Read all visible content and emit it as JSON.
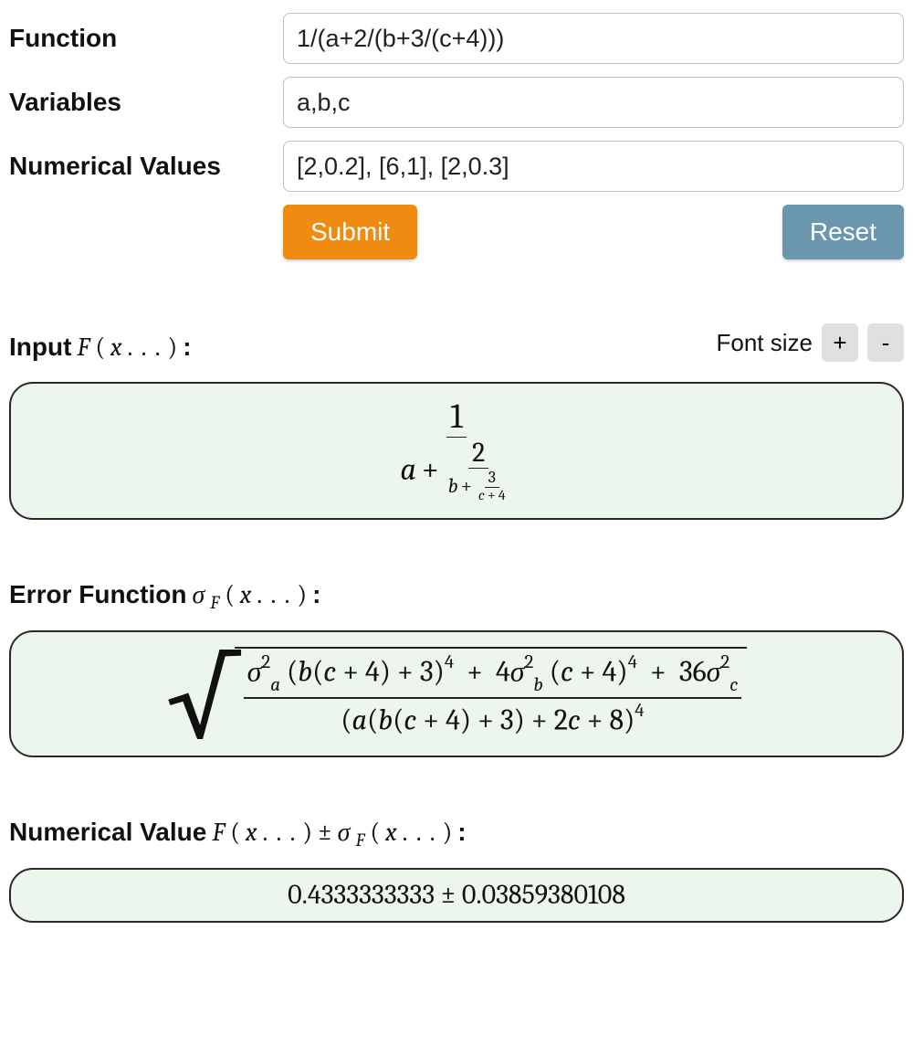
{
  "form": {
    "function_label": "Function",
    "variables_label": "Variables",
    "values_label": "Numerical Values",
    "function_value": "1/(a+2/(b+3/(c+4)))",
    "variables_value": "a,b,c",
    "values_value": "[2,0.2], [6,1], [2,0.3]",
    "submit_label": "Submit",
    "reset_label": "Reset"
  },
  "font_size": {
    "label": "Font size",
    "plus": "+",
    "minus": "-"
  },
  "sections": {
    "input_prefix": "Input ",
    "input_math_F": "F",
    "input_math_open": "(",
    "input_math_x": "x",
    "input_math_dots": ". . .",
    "input_math_close": ")",
    "input_colon": ":",
    "error_prefix": "Error Function ",
    "error_sigma": "σ",
    "error_sub_F": "F",
    "numerical_prefix": "Numerical Value ",
    "pm": "±"
  },
  "formula1": {
    "top": "1",
    "a": "a",
    "plus1": "+",
    "two": "2",
    "b": "b",
    "plus2": "+",
    "three": "3",
    "c": "c",
    "plus3": "+",
    "four": "4"
  },
  "formula2": {
    "num": {
      "t1_sigma": "σ",
      "t1_sup": "2",
      "t1_sub": "a",
      "t1_open": "(",
      "t1_b": "b",
      "t1_open2": "(",
      "t1_c": "c",
      "t1_plus": "+",
      "t1_4": "4",
      "t1_close2": ")",
      "t1_plus2": "+",
      "t1_3": "3",
      "t1_close": ")",
      "t1_pow": "4",
      "plusA": "+",
      "t2_4": "4",
      "t2_sigma": "σ",
      "t2_sup": "2",
      "t2_sub": "b",
      "t2_open": "(",
      "t2_c": "c",
      "t2_plus": "+",
      "t2_fr4": "4",
      "t2_close": ")",
      "t2_pow": "4",
      "plusB": "+",
      "t3_36": "36",
      "t3_sigma": "σ",
      "t3_sup": "2",
      "t3_sub": "c"
    },
    "den": {
      "open": "(",
      "a": "a",
      "open2": "(",
      "b": "b",
      "open3": "(",
      "c": "c",
      "plus1": "+",
      "four": "4",
      "close3": ")",
      "plus2": "+",
      "three": "3",
      "close2": ")",
      "plus3": "+",
      "two_c": "2",
      "c2": "c",
      "plus4": "+",
      "eight": "8",
      "close": ")",
      "pow": "4"
    }
  },
  "result": {
    "value": "0.4333333333",
    "pm": "±",
    "error": "0.03859380108"
  }
}
